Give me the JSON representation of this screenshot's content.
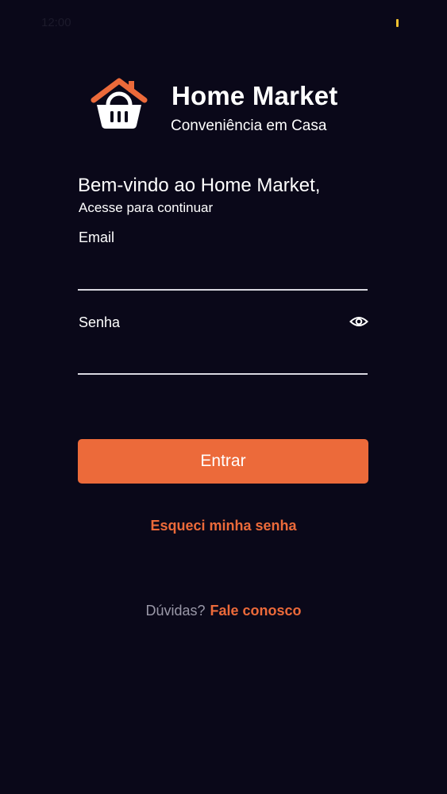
{
  "status_bar": {
    "time": "12:00"
  },
  "brand": {
    "name": "Home Market",
    "tagline": "Conveniência em Casa",
    "logo_icon": "basket-house-icon"
  },
  "welcome": {
    "title": "Bem-vindo ao Home Market,",
    "subtitle": "Acesse para continuar"
  },
  "form": {
    "email": {
      "label": "Email",
      "value": ""
    },
    "password": {
      "label": "Senha",
      "value": "",
      "toggle_icon": "eye-icon"
    },
    "submit_label": "Entrar"
  },
  "forgot_password": "Esqueci minha senha",
  "help": {
    "text": "Dúvidas?",
    "link": "Fale conosco"
  },
  "colors": {
    "background": "#0a0819",
    "accent": "#ec6a3a",
    "text": "#ffffff",
    "muted": "#9a98a8"
  }
}
